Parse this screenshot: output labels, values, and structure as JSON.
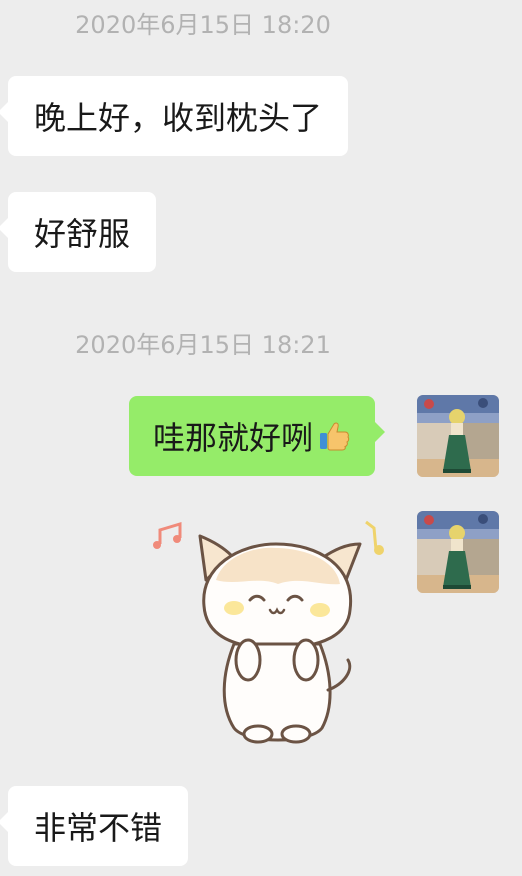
{
  "chat": {
    "messages": [
      {
        "kind": "timestamp",
        "text": "2020年6月15日 18:20"
      },
      {
        "kind": "text",
        "side": "left",
        "text": "晚上好，收到枕头了"
      },
      {
        "kind": "text",
        "side": "left",
        "text": "好舒服"
      },
      {
        "kind": "timestamp",
        "text": "2020年6月15日 18:21"
      },
      {
        "kind": "text",
        "side": "right",
        "text": "哇那就好咧",
        "emoji": "thumbs-up-icon"
      },
      {
        "kind": "sticker",
        "side": "right",
        "sticker": "white-cat-sticker"
      },
      {
        "kind": "text",
        "side": "left",
        "text": "非常不错"
      }
    ]
  },
  "colors": {
    "background": "#ededed",
    "incoming_bubble": "#ffffff",
    "outgoing_bubble": "#95ec69",
    "timestamp_text": "#b2b2b2",
    "message_text": "#191919"
  }
}
